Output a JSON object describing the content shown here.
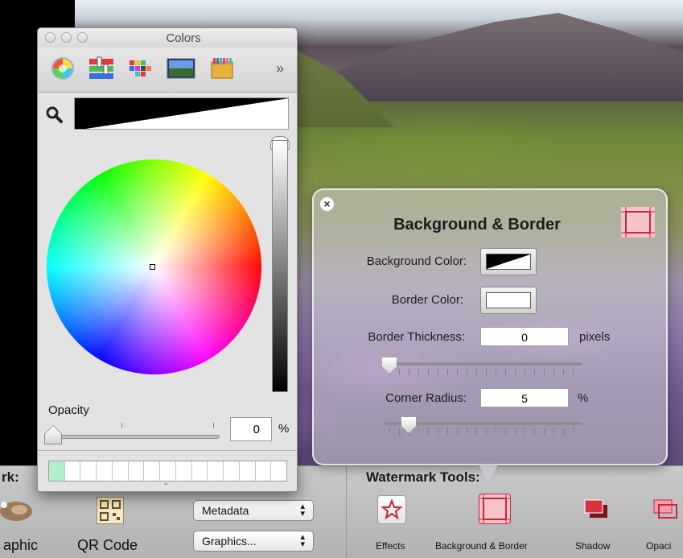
{
  "colors_window": {
    "title": "Colors",
    "tabs": [
      {
        "name": "color-wheel",
        "selected": true
      },
      {
        "name": "color-sliders",
        "selected": false
      },
      {
        "name": "color-palettes",
        "selected": false
      },
      {
        "name": "image-palettes",
        "selected": false
      },
      {
        "name": "crayons",
        "selected": false
      }
    ],
    "more_tabs": "»",
    "opacity_label": "Opacity",
    "opacity_value": "0",
    "opacity_unit": "%",
    "current_color": "#000000",
    "favorite_swatch_color": "#aff0c9"
  },
  "hud": {
    "title": "Background & Border",
    "background_color_label": "Background Color:",
    "border_color_label": "Border Color:",
    "border_thickness_label": "Border Thickness:",
    "border_thickness_value": "0",
    "border_thickness_unit": "pixels",
    "corner_radius_label": "Corner Radius:",
    "corner_radius_value": "5",
    "corner_radius_unit": "%",
    "border_color": "#ffffff",
    "background_color": "#000000"
  },
  "toolbar": {
    "left_title_fragment": "rk:",
    "graphic_label": "aphic",
    "qr_label": "QR Code",
    "metadata_popup": "Metadata",
    "graphics_popup": "Graphics...",
    "watermark_tools_title": "Watermark Tools:",
    "tools": [
      {
        "label": "Effects",
        "icon": "star-icon"
      },
      {
        "label": "Background & Border",
        "icon": "background-border-icon"
      },
      {
        "label": "Shadow",
        "icon": "shadow-icon"
      },
      {
        "label": "Opaci",
        "icon": "opacity-icon"
      }
    ]
  }
}
